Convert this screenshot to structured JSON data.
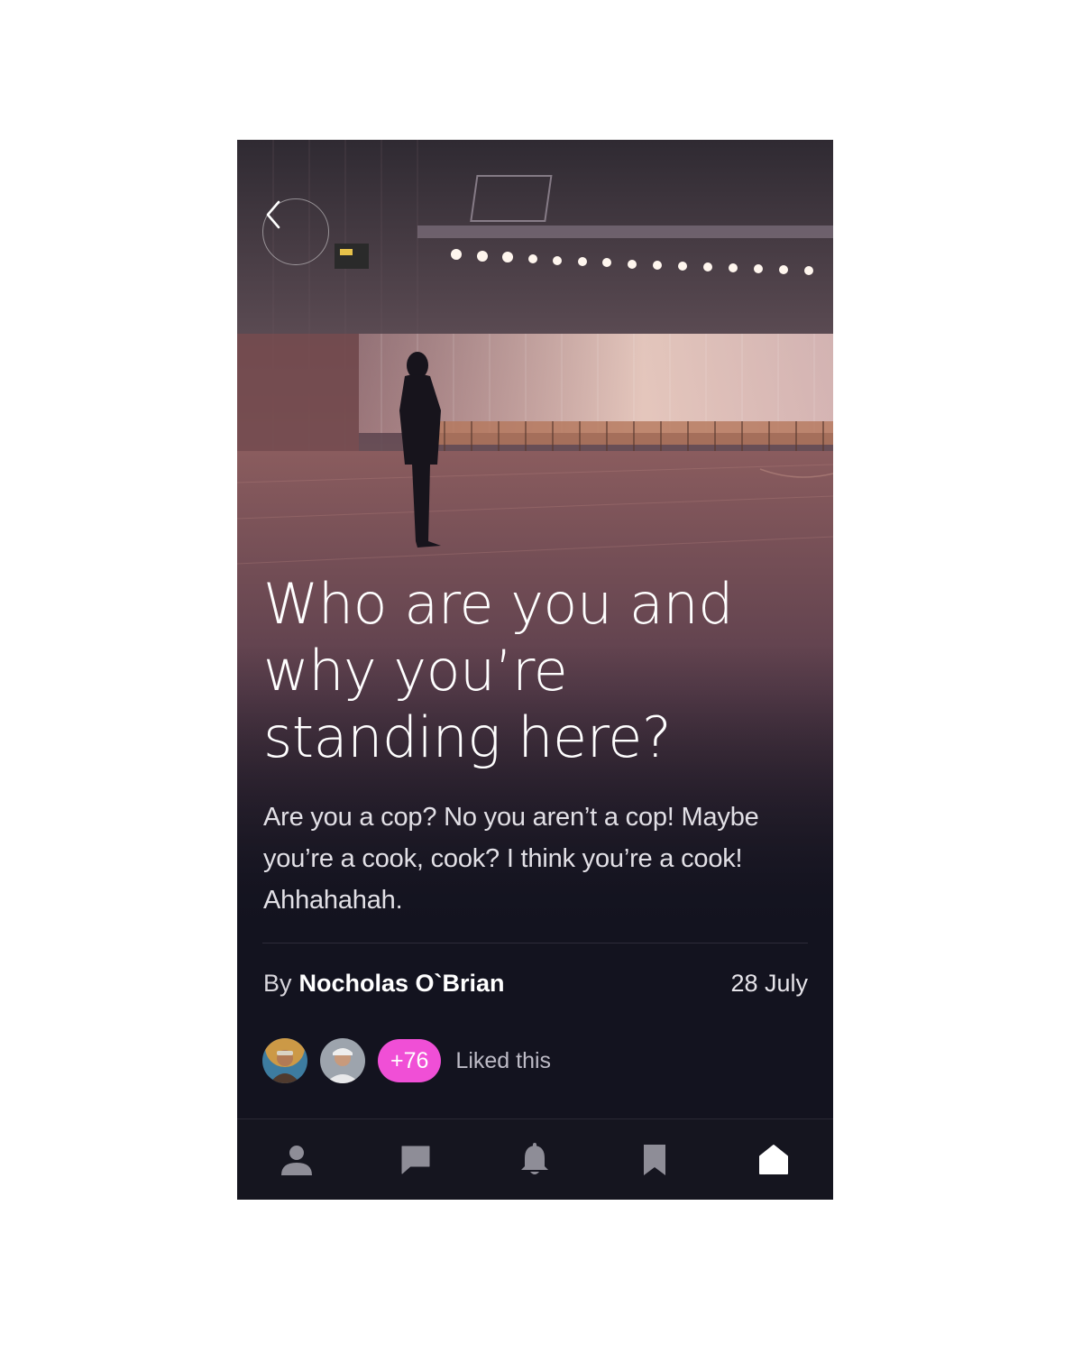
{
  "article": {
    "headline": "Who are you and why you’re standing here?",
    "body": "Are you a cop? No you aren’t a cop! Maybe you’re a cook, cook? I think you’re a cook! Ahhahahah.",
    "by_prefix": "By",
    "author": "Nocholas O`Brian",
    "date": "28 July"
  },
  "likes": {
    "more_count": "+76",
    "label": "Liked this",
    "badge_color": "#f04fd6"
  },
  "icons": {
    "back": "chevron-left-icon",
    "nav": [
      "profile-icon",
      "chat-icon",
      "bell-icon",
      "bookmark-icon",
      "home-icon"
    ]
  },
  "nav": {
    "active": "home",
    "inactive_color": "#8e8d97",
    "active_color": "#ffffff"
  },
  "colors": {
    "background": "#13131f",
    "accent": "#f04fd6"
  }
}
